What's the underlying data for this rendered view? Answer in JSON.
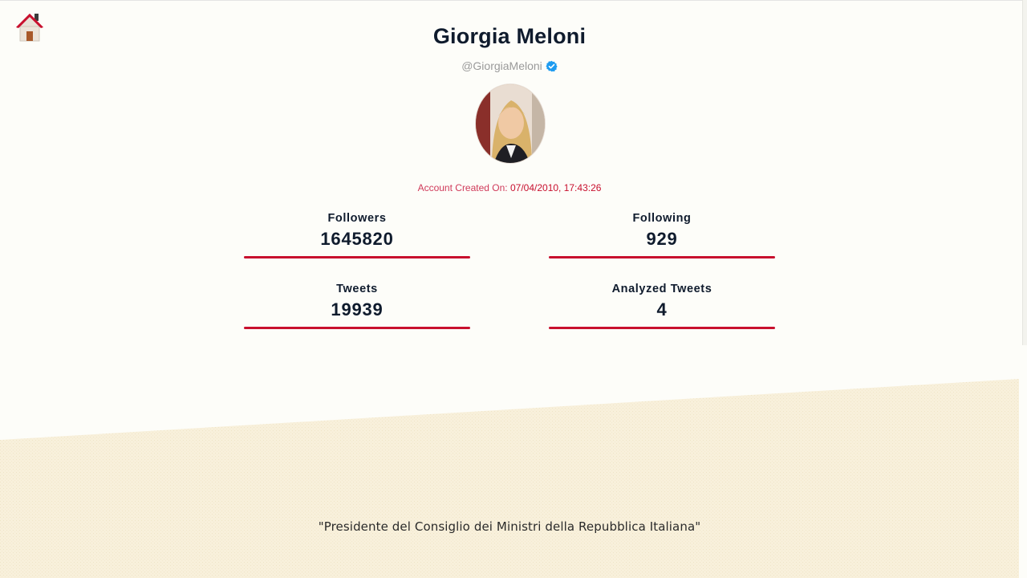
{
  "profile": {
    "name": "Giorgia Meloni",
    "handle": "@GiorgiaMeloni",
    "verified": true,
    "created_label": "Account Created On:",
    "created_value": "07/04/2010, 17:43:26"
  },
  "stats": {
    "followers": {
      "label": "Followers",
      "value": "1645820"
    },
    "following": {
      "label": "Following",
      "value": "929"
    },
    "tweets": {
      "label": "Tweets",
      "value": "19939"
    },
    "analyzed": {
      "label": "Analyzed Tweets",
      "value": "4"
    }
  },
  "bio": "\"Presidente del Consiglio dei Ministri della Repubblica Italiana\"",
  "icons": {
    "home": "home-icon",
    "verified": "verified-badge-icon"
  },
  "colors": {
    "accent": "#c8102e",
    "text": "#0f1b2d",
    "band": "#f7efd9",
    "background": "#fdfdf9"
  }
}
